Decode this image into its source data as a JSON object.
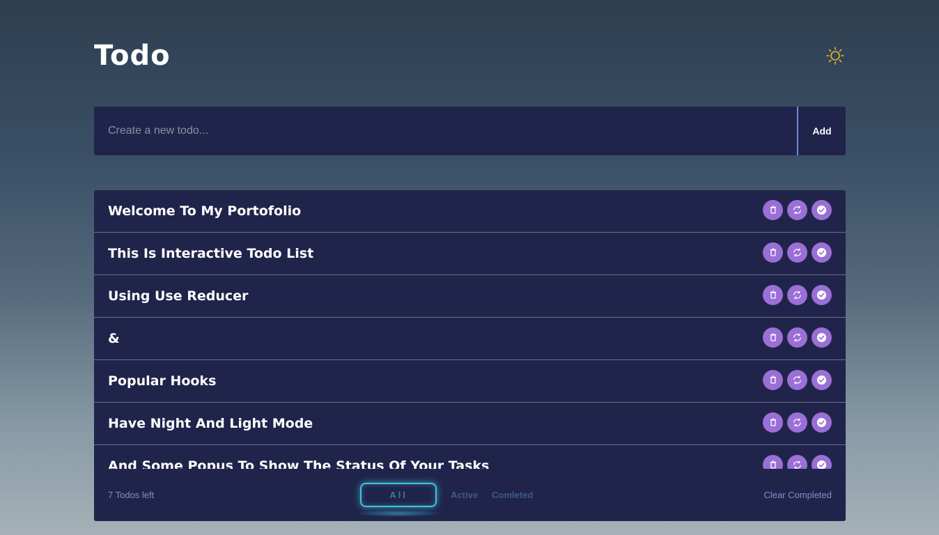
{
  "header": {
    "title": "Todo",
    "theme_icon": "sun-icon",
    "accent_color": "#e8b52a"
  },
  "input": {
    "placeholder": "Create a new todo...",
    "value": "",
    "add_label": "Add"
  },
  "todos": [
    {
      "text": "Welcome To My Portofolio"
    },
    {
      "text": "This Is Interactive Todo List"
    },
    {
      "text": "Using Use Reducer"
    },
    {
      "text": "&"
    },
    {
      "text": "Popular Hooks"
    },
    {
      "text": "Have Night And Light Mode"
    },
    {
      "text": "And Some Popus To Show The Status Of Your Tasks"
    }
  ],
  "row_action_icons": [
    "trash-icon",
    "refresh-icon",
    "check-circle-icon"
  ],
  "footer": {
    "count_label": "7 Todos left",
    "filters": [
      "All",
      "Active",
      "Comleted"
    ],
    "active_filter": "All",
    "clear_label": "Clear Completed"
  },
  "colors": {
    "panel": "#20244a",
    "action_button": "#9a6fd6",
    "filter_glow": "#3fc4dd"
  }
}
